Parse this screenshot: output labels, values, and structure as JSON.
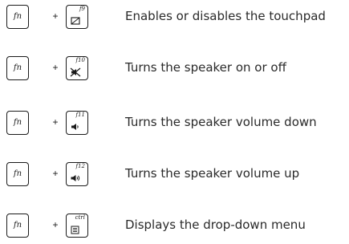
{
  "shortcuts": [
    {
      "modifier": "fn",
      "plus": "+",
      "key": "f9",
      "icon": "touchpad-icon",
      "description": "Enables or disables the touchpad"
    },
    {
      "modifier": "fn",
      "plus": "+",
      "key": "f10",
      "icon": "speaker-mute-icon",
      "description": "Turns the speaker on or off"
    },
    {
      "modifier": "fn",
      "plus": "+",
      "key": "f11",
      "icon": "volume-down-icon",
      "description": "Turns the speaker volume down"
    },
    {
      "modifier": "fn",
      "plus": "+",
      "key": "f12",
      "icon": "volume-up-icon",
      "description": "Turns the speaker volume up"
    },
    {
      "modifier": "fn",
      "plus": "+",
      "key": "ctrl",
      "icon": "menu-icon",
      "description": "Displays the drop-down menu"
    }
  ]
}
